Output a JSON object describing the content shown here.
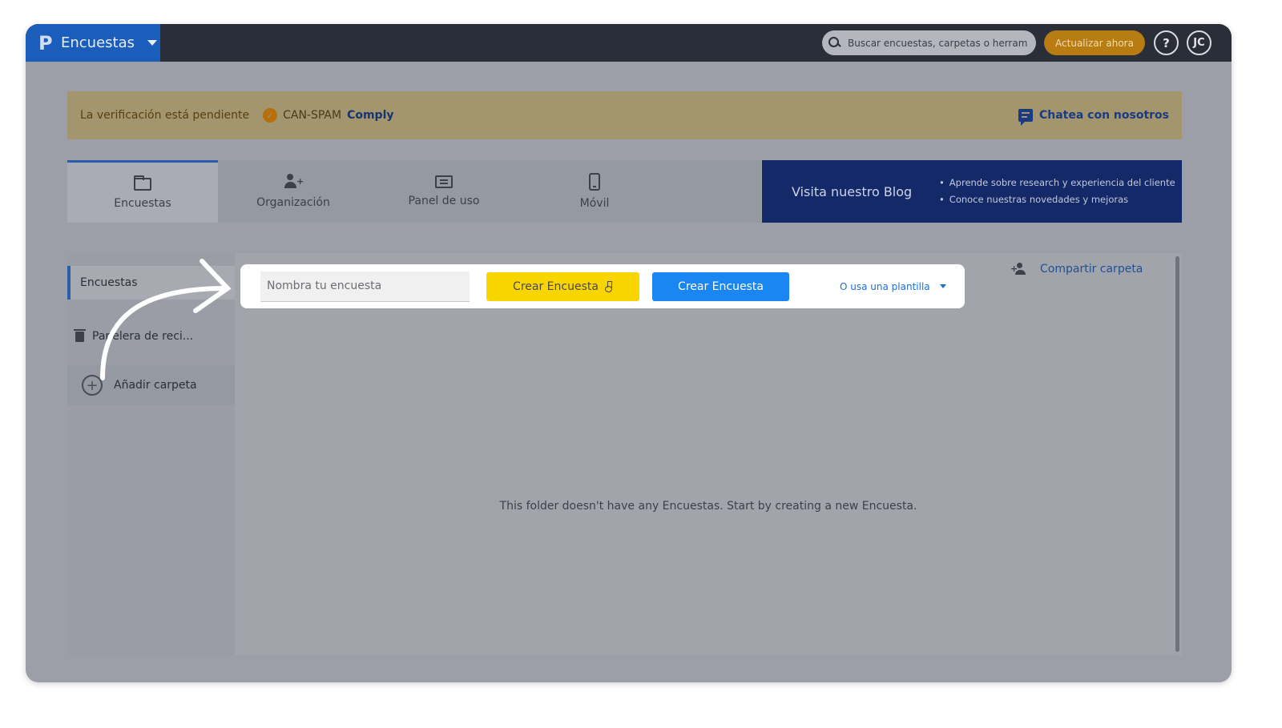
{
  "topbar": {
    "app_logo": "P",
    "app_name": "Encuestas",
    "search_placeholder": "Buscar encuestas, carpetas o herrami",
    "upgrade_label": "Actualizar ahora",
    "help_label": "?",
    "avatar_initials": "JC"
  },
  "banner": {
    "pending_text": "La verificación está pendiente",
    "badge_text": "CAN-SPAM",
    "comply_text": "Comply",
    "chat_label": "Chatea con nosotros"
  },
  "tabs": [
    {
      "label": "Encuestas",
      "icon": "folder-icon"
    },
    {
      "label": "Organización",
      "icon": "people-icon"
    },
    {
      "label": "Panel de uso",
      "icon": "panel-icon"
    },
    {
      "label": "Móvil",
      "icon": "mobile-icon"
    }
  ],
  "blog": {
    "title": "Visita nuestro Blog",
    "items": [
      "Aprende sobre research y experiencia del cliente",
      "Conoce nuestras novedades y mejoras"
    ]
  },
  "sidebar": {
    "items": [
      {
        "label": "Encuestas"
      },
      {
        "label": "Papelera de reci..."
      }
    ],
    "add_folder_label": "Añadir carpeta"
  },
  "create": {
    "name_placeholder": "Nombra tu encuesta",
    "yellow_button_label": "Crear Encuesta",
    "blue_button_label": "Crear Encuesta",
    "template_label": "O usa una plantilla"
  },
  "share_folder_label": "Compartir carpeta",
  "empty_message": "This folder doesn't have any Encuestas. Start by creating a new Encuesta.",
  "colors": {
    "brand_blue": "#1a5dba",
    "primary_button": "#1a86f2",
    "yellow_button": "#f9d500",
    "upgrade": "#b77c12",
    "blog_bg": "#142a68"
  }
}
